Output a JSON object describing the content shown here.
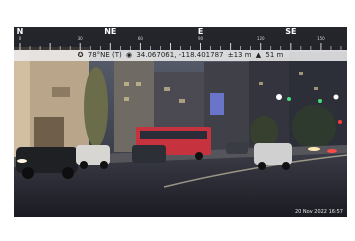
{
  "compass": {
    "cardinals": [
      {
        "label": "N",
        "deg": 0
      },
      {
        "label": "NE",
        "deg": 45
      },
      {
        "label": "E",
        "deg": 90
      },
      {
        "label": "SE",
        "deg": 135
      }
    ],
    "degree_labels": [
      {
        "label": "0",
        "deg": 0
      },
      {
        "label": "30",
        "deg": 30
      },
      {
        "label": "60",
        "deg": 60
      },
      {
        "label": "90",
        "deg": 90
      },
      {
        "label": "120",
        "deg": 120
      },
      {
        "label": "150",
        "deg": 150
      }
    ],
    "start_deg": -3,
    "end_deg": 163
  },
  "info": {
    "heading": "78°NE (T)",
    "coordinates": "34.067061, -118.401787",
    "accuracy": "±13 m",
    "altitude": "51 m"
  },
  "timestamp": "20 Nov 2022 16:57",
  "icons": {
    "heading": "compass-direction-icon",
    "location": "location-pin-icon",
    "altitude": "altitude-triangle-icon"
  }
}
